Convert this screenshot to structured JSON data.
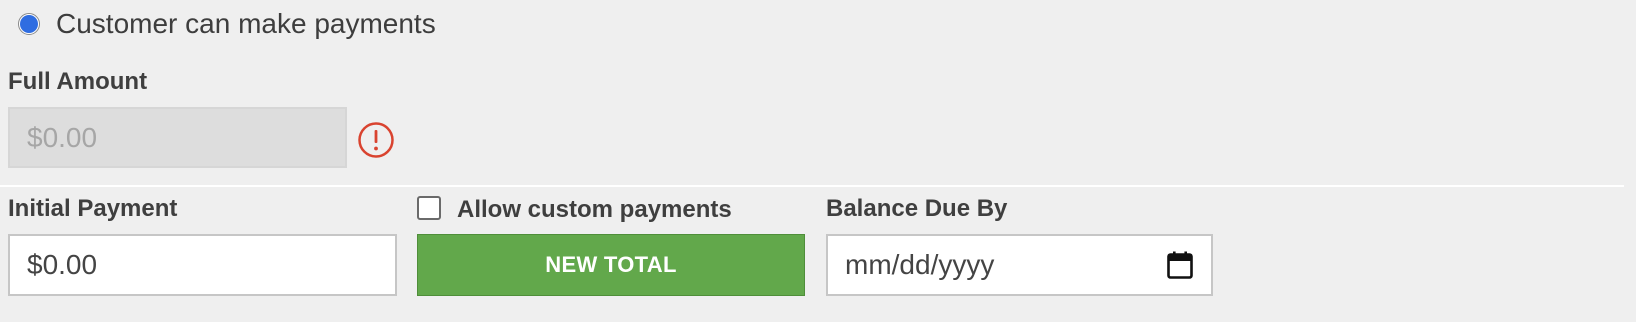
{
  "payment_option": {
    "label": "Customer can make payments",
    "selected": true
  },
  "full_amount": {
    "label": "Full Amount",
    "value": "$0.00",
    "error_icon": "exclamation-circle-icon"
  },
  "initial_payment": {
    "label": "Initial Payment",
    "value": "$0.00"
  },
  "custom_payments": {
    "label": "Allow custom payments",
    "checked": false
  },
  "new_total_button": {
    "label": "NEW TOTAL"
  },
  "balance_due": {
    "label": "Balance Due By",
    "placeholder": "mm/dd/yyyy",
    "icon": "calendar-icon"
  },
  "colors": {
    "radio_accent": "#2f6de1",
    "button_green": "#62a84b",
    "error_red": "#d9432f"
  }
}
